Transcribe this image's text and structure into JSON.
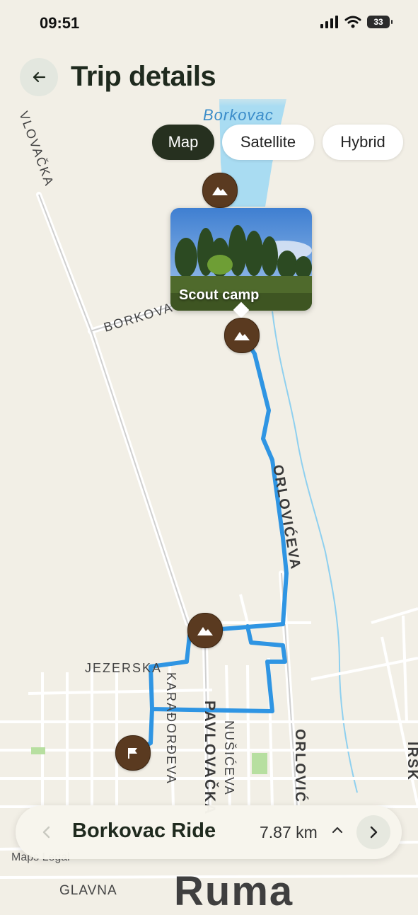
{
  "status_bar": {
    "time": "09:51",
    "battery": "33"
  },
  "header": {
    "title": "Trip details",
    "back_icon": "arrow-left-icon"
  },
  "map_types": [
    {
      "label": "Map",
      "active": true
    },
    {
      "label": "Satellite",
      "active": false
    },
    {
      "label": "Hybrid",
      "active": false
    }
  ],
  "map": {
    "water_label": "Borkovac",
    "streets": [
      "VLOVAČKA",
      "BORKOVAČ",
      "ORLOVIĆEVA",
      "JEZERSKA",
      "KARAĐORĐEVA",
      "PAVLOVAČKA",
      "NUŠIĆEVA",
      "ORLOVIĆ",
      "IRSK",
      "GLAVNA"
    ],
    "town": "Ruma",
    "attribution": "Maps  Legal",
    "route_color": "#2f95e3"
  },
  "photo_card": {
    "label": "Scout camp"
  },
  "markers": [
    {
      "type": "mountain-icon"
    },
    {
      "type": "mountain-icon"
    },
    {
      "type": "mountain-icon"
    },
    {
      "type": "flag-icon"
    }
  ],
  "trip": {
    "name": "Borkovac Ride",
    "distance": "7.87 km"
  }
}
